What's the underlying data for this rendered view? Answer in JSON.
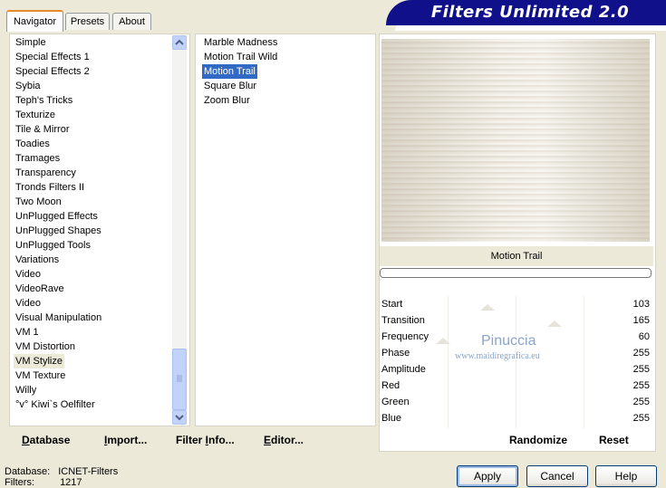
{
  "banner": {
    "title": "Filters Unlimited 2.0"
  },
  "tabs": [
    {
      "label": "Navigator",
      "active": true
    },
    {
      "label": "Presets",
      "active": false
    },
    {
      "label": "About",
      "active": false
    }
  ],
  "categories": [
    "Simple",
    "Special Effects 1",
    "Special Effects 2",
    "Sybia",
    "Teph's Tricks",
    "Texturize",
    "Tile & Mirror",
    "Toadies",
    "Tramages",
    "Transparency",
    "Tronds Filters II",
    "Two Moon",
    "UnPlugged Effects",
    "UnPlugged Shapes",
    "UnPlugged Tools",
    "Variations",
    "Video",
    "VideoRave",
    "Video",
    "Visual Manipulation",
    "VM 1",
    "VM Distortion",
    "VM Stylize",
    "VM Texture",
    "Willy",
    "°v° Kiwi`s Oelfilter"
  ],
  "selected_category": "VM Stylize",
  "filters": [
    "Marble Madness",
    "Motion Trail Wild",
    "Motion Trail",
    "Square Blur",
    "Zoom Blur"
  ],
  "selected_filter": "Motion Trail",
  "filter_title": "Motion Trail",
  "params": [
    {
      "label": "Start",
      "value": "103"
    },
    {
      "label": "Transition",
      "value": "165"
    },
    {
      "label": "Frequency",
      "value": "60"
    },
    {
      "label": "Phase",
      "value": "255"
    },
    {
      "label": "Amplitude",
      "value": "255"
    },
    {
      "label": "Red",
      "value": "255"
    },
    {
      "label": "Green",
      "value": "255"
    },
    {
      "label": "Blue",
      "value": "255"
    }
  ],
  "watermark": {
    "name": "Pinuccia",
    "url": "www.maidiregrafica.eu"
  },
  "toolbar": {
    "database": {
      "underline": "D",
      "rest": "atabase"
    },
    "import": {
      "underline": "I",
      "rest": "mport..."
    },
    "filter_info": {
      "pre": "Filter ",
      "underline": "I",
      "rest": "nfo..."
    },
    "editor": {
      "underline": "E",
      "rest": "ditor..."
    },
    "randomize": "Randomize",
    "reset": "Reset"
  },
  "status": {
    "database_label": "Database:",
    "database_value": "ICNET-Filters",
    "filters_label": "Filters:",
    "filters_value": "1217"
  },
  "buttons": {
    "apply": "Apply",
    "cancel": "Cancel",
    "help": "Help"
  },
  "colors": {
    "banner": "#10108a",
    "selection": "#316ac5",
    "tab_accent": "#e68b2c"
  }
}
